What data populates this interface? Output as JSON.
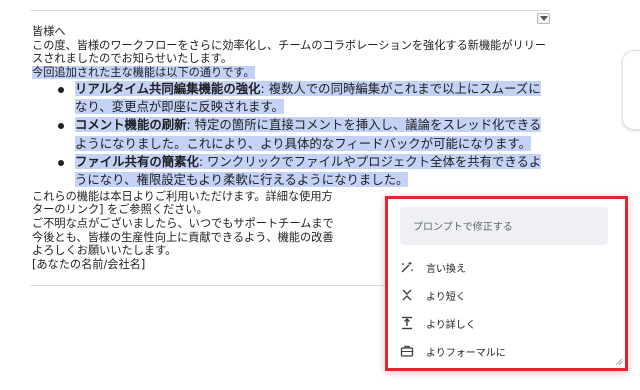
{
  "document": {
    "greeting": "皆様へ",
    "intro": "この度、皆様のワークフローをさらに効率化し、チームのコラボレーションを強化する新機能がリリースされましたのでお知らせいたします。",
    "features_lead": "今回追加された主な機能は以下の通りです。",
    "features": [
      {
        "title": "リアルタイム共同編集機能の強化",
        "desc": ": 複数人での同時編集がこれまで以上にスムーズになり、変更点が即座に反映されます。"
      },
      {
        "title": "コメント機能の刷新",
        "desc": ": 特定の箇所に直接コメントを挿入し、議論をスレッド化できるようになりました。これにより、より具体的なフィードバックが可能になります。"
      },
      {
        "title": "ファイル共有の簡素化",
        "desc": ": ワンクリックでファイルやプロジェクト全体を共有できるようになり、権限設定もより柔軟に行えるようになりました。"
      }
    ],
    "closing_lines": [
      "これらの機能は本日よりご利用いただけます。詳細な使用方",
      "ターのリンク] をご参照ください。",
      "ご不明な点がございましたら、いつでもサポートチームまで",
      "今後とも、皆様の生産性向上に貢献できるよう、機能の改善",
      "よろしくお願いいたします。",
      "[あなたの名前/会社名]"
    ]
  },
  "popup": {
    "prompt_placeholder": "プロンプトで修正する",
    "items": [
      {
        "label": "言い換え",
        "icon": "rephrase-icon"
      },
      {
        "label": "より短く",
        "icon": "shorten-icon"
      },
      {
        "label": "より詳しく",
        "icon": "elaborate-icon"
      },
      {
        "label": "よりフォーマルに",
        "icon": "briefcase-icon"
      }
    ]
  },
  "colors": {
    "highlight": "#c3d2f5",
    "popup_border": "#e3262b",
    "prompt_bg": "#eef0f4"
  }
}
